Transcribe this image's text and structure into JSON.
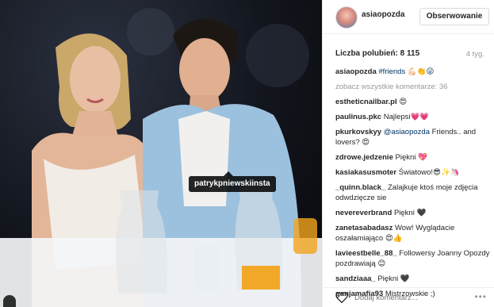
{
  "post": {
    "tagged_user": "patrykpniewskiinsta"
  },
  "header": {
    "username": "asiaopozda",
    "follow_label": "Obserwowanie"
  },
  "stats": {
    "likes": "Liczba polubień: 8 115",
    "time": "4 tyg."
  },
  "caption": {
    "user": "asiaopozda",
    "text": "#friends 💪🏻👏😜"
  },
  "view_all": "zobacz wszystkie komentarze: 36",
  "comments": [
    {
      "user": "estheticnailbar.pl",
      "text": "😍"
    },
    {
      "user": "paulinus.pkc",
      "text": "Najlepsi💗💗"
    },
    {
      "user": "pkurkovskyy",
      "mention": "@asiaopozda",
      "text": " Friends.. and lovers? 😍"
    },
    {
      "user": "zdrowe.jedzenie",
      "text": "Piękni 💖"
    },
    {
      "user": "kasiakasusmoter",
      "text": "Światowo!😎✨🦄"
    },
    {
      "user": "_quinn.black_",
      "text": "Zalajkuje ktoś moje zdjęcia odwdzięcze sie"
    },
    {
      "user": "nevereverbrand",
      "text": "Piękni 🖤"
    },
    {
      "user": "zanetasabadasz",
      "text": "Wow! Wyglądacie oszałamiająco 😍👍"
    },
    {
      "user": "lavieestbelle_88_",
      "text": "Followersy Joanny Opozdy pozdrawiają 😊"
    },
    {
      "user": "sandziaaa_",
      "text": "Piękni 🖤"
    },
    {
      "user": "ganjamafia93",
      "text": "Mistrzowskie ;)"
    }
  ],
  "footer": {
    "comment_placeholder": "Dodaj komentarz...",
    "more_label": "•••"
  }
}
